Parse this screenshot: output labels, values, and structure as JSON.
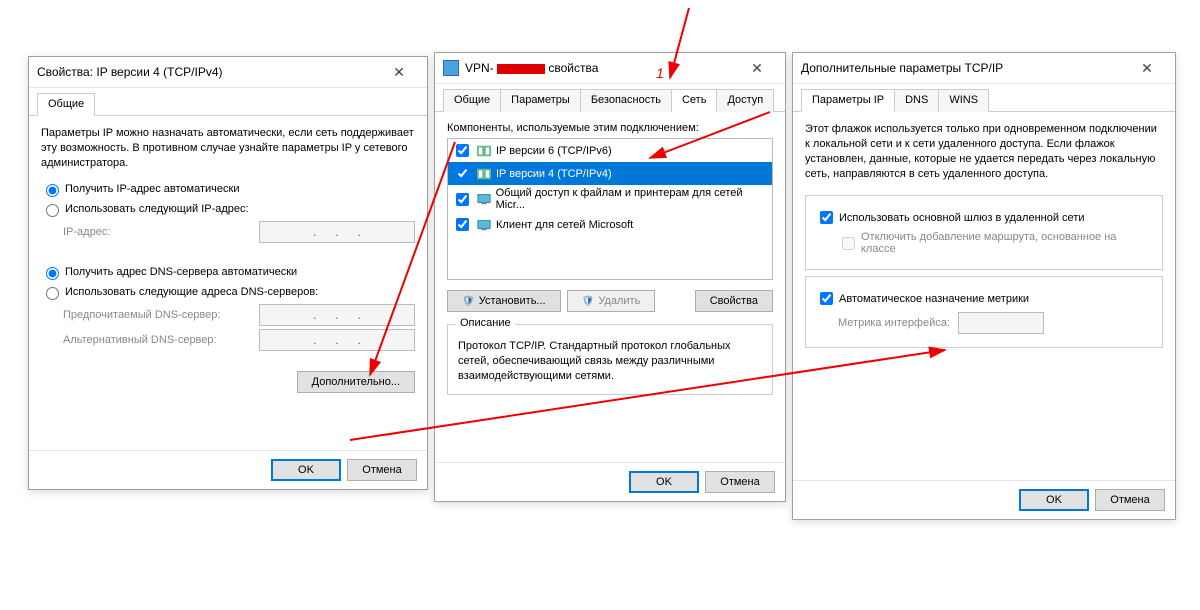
{
  "dlg1": {
    "title": "Свойства: IP версии 4 (TCP/IPv4)",
    "tabs": {
      "general": "Общие"
    },
    "intro": "Параметры IP можно назначать автоматически, если сеть поддерживает эту возможность. В противном случае узнайте параметры IP у сетевого администратора.",
    "radio": {
      "auto_ip": "Получить IP-адрес автоматически",
      "manual_ip": "Использовать следующий IP-адрес:",
      "auto_dns": "Получить адрес DNS-сервера автоматически",
      "manual_dns": "Использовать следующие адреса DNS-серверов:"
    },
    "fields": {
      "ip": "IP-адрес:",
      "pref_dns": "Предпочитаемый DNS-сервер:",
      "alt_dns": "Альтернативный DNS-сервер:",
      "placeholder": ".     .     ."
    },
    "buttons": {
      "advanced": "Дополнительно...",
      "ok": "OK",
      "cancel": "Отмена"
    }
  },
  "dlg2": {
    "title_prefix": "VPN-",
    "title_suffix": "свойства",
    "tabs": {
      "general": "Общие",
      "params": "Параметры",
      "security": "Безопасность",
      "network": "Сеть",
      "access": "Доступ"
    },
    "components_label": "Компоненты, используемые этим подключением:",
    "items": [
      {
        "label": "IP версии 6 (TCP/IPv6)",
        "checked": true
      },
      {
        "label": "IP версии 4 (TCP/IPv4)",
        "checked": true,
        "selected": true
      },
      {
        "label": "Общий доступ к файлам и принтерам для сетей Micr...",
        "checked": true
      },
      {
        "label": "Клиент для сетей Microsoft",
        "checked": true
      }
    ],
    "buttons": {
      "install": "Установить...",
      "remove": "Удалить",
      "props": "Свойства",
      "ok": "OK",
      "cancel": "Отмена"
    },
    "desc_title": "Описание",
    "desc": "Протокол TCP/IP. Стандартный протокол глобальных сетей, обеспечивающий связь между различными взаимодействующими сетями."
  },
  "dlg3": {
    "title": "Дополнительные параметры TCP/IP",
    "tabs": {
      "ip": "Параметры IP",
      "dns": "DNS",
      "wins": "WINS"
    },
    "intro": "Этот флажок используется только при одновременном подключении к локальной сети и к сети удаленного доступа. Если флажок установлен, данные, которые не удается передать через локальную сеть, направляются в сеть удаленного доступа.",
    "checks": {
      "use_gw": "Использовать основной шлюз в удаленной сети",
      "disable_route": "Отключить добавление маршрута, основанное на классе",
      "auto_metric": "Автоматическое назначение метрики",
      "metric_label": "Метрика интерфейса:"
    },
    "buttons": {
      "ok": "OK",
      "cancel": "Отмена"
    }
  },
  "annot": {
    "label1": "1"
  }
}
